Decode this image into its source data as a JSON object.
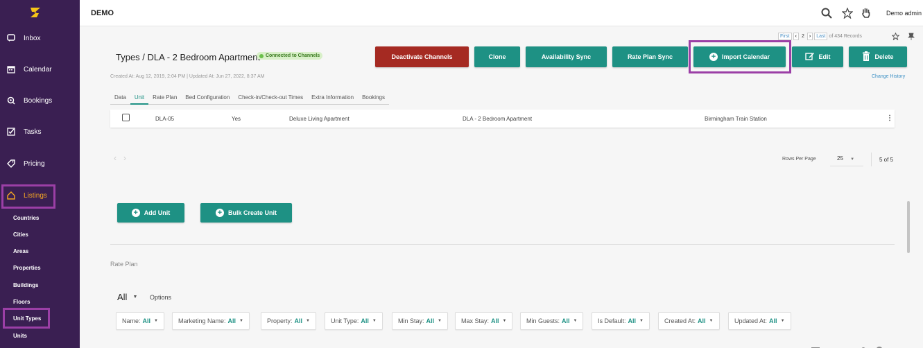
{
  "app": {
    "title": "DEMO",
    "user": "Demo admin"
  },
  "sidebar": {
    "items": [
      {
        "label": "Inbox",
        "icon": "inbox-icon"
      },
      {
        "label": "Calendar",
        "icon": "calendar-icon"
      },
      {
        "label": "Bookings",
        "icon": "bookings-icon"
      },
      {
        "label": "Tasks",
        "icon": "tasks-icon"
      },
      {
        "label": "Pricing",
        "icon": "tag-icon"
      },
      {
        "label": "Listings",
        "icon": "home-icon"
      }
    ],
    "subitems": [
      "Countries",
      "Cities",
      "Areas",
      "Properties",
      "Buildings",
      "Floors",
      "Unit Types",
      "Units"
    ]
  },
  "pager": {
    "first": "First",
    "current": "2",
    "last": "Last",
    "records": "of 434 Records"
  },
  "header": {
    "title": "Types / DLA - 2 Bedroom Apartment",
    "badge": "Connected to Channels",
    "meta": "Created At: Aug 12, 2019, 2:04 PM  |  Updated At: Jun 27, 2022, 8:37 AM",
    "change_history": "Change History"
  },
  "actions": {
    "deactivate": "Deactivate Channels",
    "clone": "Clone",
    "availability_sync": "Availability Sync",
    "rate_plan_sync": "Rate Plan Sync",
    "import_calendar": "Import Calendar",
    "edit": "Edit",
    "delete": "Delete"
  },
  "tabs": [
    "Data",
    "Unit",
    "Rate Plan",
    "Bed Configuration",
    "Check-in/Check-out Times",
    "Extra Information",
    "Bookings"
  ],
  "unit_row": {
    "code": "DLA-05",
    "active": "Yes",
    "type": "Deluxe Living Apartment",
    "unit_type": "DLA - 2 Bedroom Apartment",
    "location": "Birmingham Train Station"
  },
  "pagination": {
    "rows_per_page_label": "Rows Per Page",
    "rows_per_page": "25",
    "count": "5 of 5"
  },
  "unit_actions": {
    "add_unit": "Add Unit",
    "bulk_create": "Bulk Create Unit"
  },
  "rate_plan": {
    "section_label": "Rate Plan",
    "all": "All",
    "options": "Options",
    "filters": [
      {
        "name": "Name:",
        "value": "All"
      },
      {
        "name": "Marketing Name:",
        "value": "All"
      },
      {
        "name": "Property:",
        "value": "All"
      },
      {
        "name": "Unit Type:",
        "value": "All"
      },
      {
        "name": "Min Stay:",
        "value": "All"
      },
      {
        "name": "Max Stay:",
        "value": "All"
      },
      {
        "name": "Min Guests:",
        "value": "All"
      },
      {
        "name": "Is Default:",
        "value": "All"
      },
      {
        "name": "Created At:",
        "value": "All"
      },
      {
        "name": "Updated At:",
        "value": "All"
      }
    ]
  },
  "colors": {
    "sidebar": "#3a1f52",
    "accent": "#1e9184",
    "danger": "#a52a22",
    "highlight": "#9b3fa6",
    "active_nav": "#f5a623"
  }
}
